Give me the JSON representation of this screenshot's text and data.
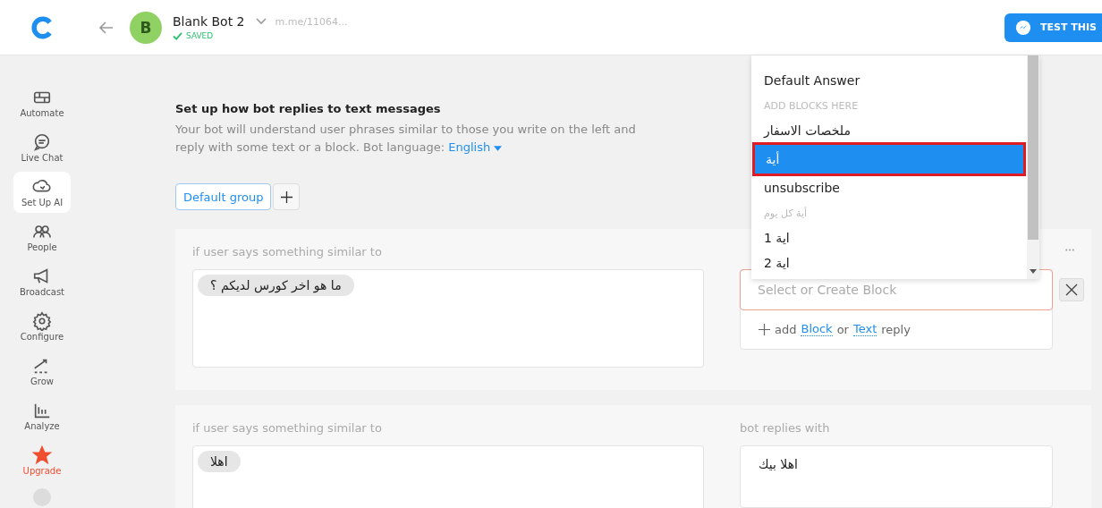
{
  "header": {
    "bot_name": "Blank Bot 2",
    "avatar_letter": "B",
    "status": "SAVED",
    "link": "m.me/11064...",
    "test_button": "TEST THIS"
  },
  "sidebar": {
    "items": [
      {
        "label": "Automate",
        "selected": false,
        "kind": "normal"
      },
      {
        "label": "Live Chat",
        "selected": false,
        "kind": "normal"
      },
      {
        "label": "Set Up AI",
        "selected": true,
        "kind": "normal"
      },
      {
        "label": "People",
        "selected": false,
        "kind": "normal"
      },
      {
        "label": "Broadcast",
        "selected": false,
        "kind": "normal"
      },
      {
        "label": "Configure",
        "selected": false,
        "kind": "normal"
      },
      {
        "label": "Grow",
        "selected": false,
        "kind": "normal"
      },
      {
        "label": "Analyze",
        "selected": false,
        "kind": "normal"
      },
      {
        "label": "Upgrade",
        "selected": false,
        "kind": "upgrade"
      }
    ]
  },
  "intro": {
    "title": "Set up how bot replies to text messages",
    "text": "Your bot will understand user phrases similar to those you write on the left and reply with some text or a block. Bot language:",
    "language": "English"
  },
  "groups": [
    {
      "label": "Default group",
      "selected": true
    }
  ],
  "rules": [
    {
      "user_label": "if user says something similar to",
      "phrases": [
        "ما هو اخر كورس لديكم ؟"
      ],
      "placeholder": "Select or Create Block",
      "add_prefix": "add",
      "add_block": "Block",
      "add_or": "or",
      "add_text": "Text",
      "add_suffix": "reply"
    },
    {
      "user_label": "if user says something similar to",
      "phrases": [
        "اهلا"
      ],
      "reply_label": "bot replies with",
      "reply_text": "اهلا بيك"
    }
  ],
  "dropdown": {
    "items": [
      {
        "kind": "item",
        "label": "Default Answer",
        "selected": false
      },
      {
        "kind": "header",
        "label": "ADD BLOCKS HERE",
        "selected": false
      },
      {
        "kind": "item",
        "label": "ملخصات الاسفار",
        "selected": false
      },
      {
        "kind": "item",
        "label": "أية",
        "selected": true
      },
      {
        "kind": "item",
        "label": "unsubscribe",
        "selected": false
      },
      {
        "kind": "header",
        "label": "أية كل يوم",
        "selected": false
      },
      {
        "kind": "item",
        "label": "اية 1",
        "selected": false
      },
      {
        "kind": "item",
        "label": "اية 2",
        "selected": false
      }
    ]
  }
}
